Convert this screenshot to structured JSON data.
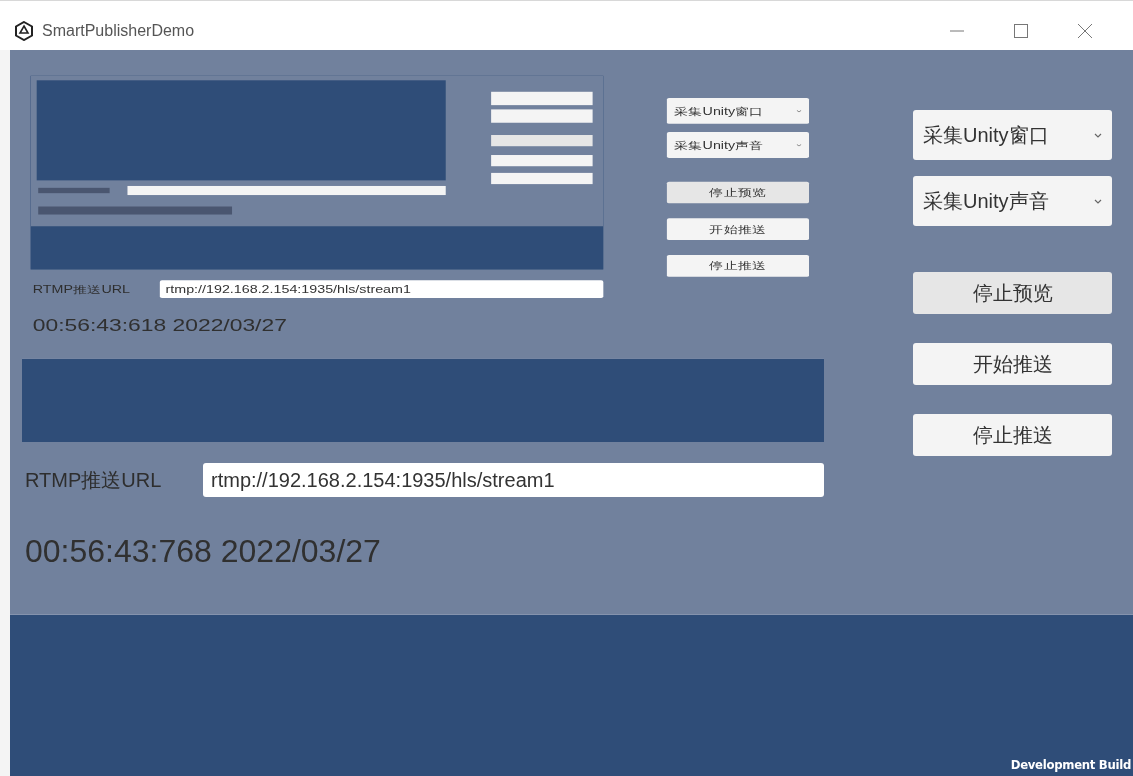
{
  "window": {
    "title": "SmartPublisherDemo"
  },
  "levels": [
    {
      "url_label": "RTMP推送URL",
      "url": "rtmp://192.168.2.154:1935/hls/stream1",
      "time": "00:56:43:618 2022/03/27",
      "controls": [
        {
          "kind": "dropdown",
          "label": "采集Unity窗口",
          "highlighted": false
        },
        {
          "kind": "dropdown",
          "label": "采集Unity声音",
          "highlighted": false
        },
        {
          "kind": "button",
          "label": "停止预览",
          "highlighted": true
        },
        {
          "kind": "button",
          "label": "开始推送",
          "highlighted": false
        },
        {
          "kind": "button",
          "label": "停止推送",
          "highlighted": false
        }
      ]
    },
    {
      "url_label": "RTMP推送URL",
      "url": "rtmp://192.168.2.154:1935/hls/stream1",
      "time": "00:56:43:768 2022/03/27",
      "controls": [
        {
          "kind": "dropdown",
          "label": "采集Unity窗口",
          "highlighted": false
        },
        {
          "kind": "dropdown",
          "label": "采集Unity声音",
          "highlighted": false
        },
        {
          "kind": "button",
          "label": "停止预览",
          "highlighted": true
        },
        {
          "kind": "button",
          "label": "开始推送",
          "highlighted": false
        },
        {
          "kind": "button",
          "label": "停止推送",
          "highlighted": false
        }
      ]
    }
  ],
  "build_label": "Development Build"
}
